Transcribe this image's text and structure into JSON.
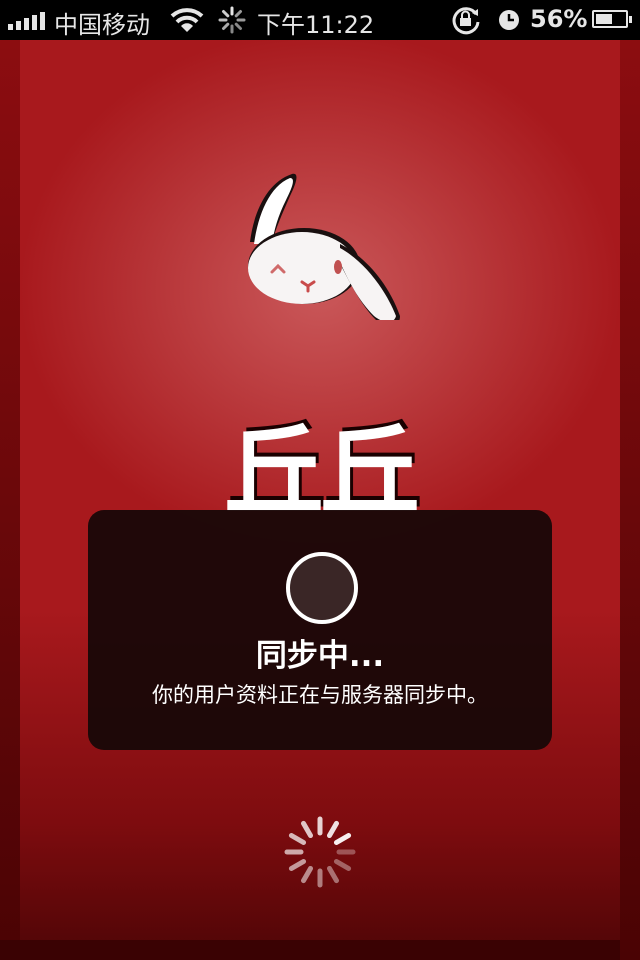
{
  "status_bar": {
    "carrier": "中国移动",
    "time": "下午11:22",
    "battery_percent": "56%",
    "battery_level": 0.56,
    "signal_bars": 5,
    "icons": [
      "signal-bars-icon",
      "wifi-icon",
      "network-activity-icon",
      "rotation-lock-icon",
      "alarm-icon",
      "battery-icon"
    ]
  },
  "app": {
    "name": "丘丘",
    "logo_icon": "rabbit-logo-icon",
    "background_color": "#a8191d"
  },
  "sync_dialog": {
    "title": "同步中...",
    "message": "你的用户资料正在与服务器同步中。"
  },
  "loading_icon": "loading-spinner-icon"
}
